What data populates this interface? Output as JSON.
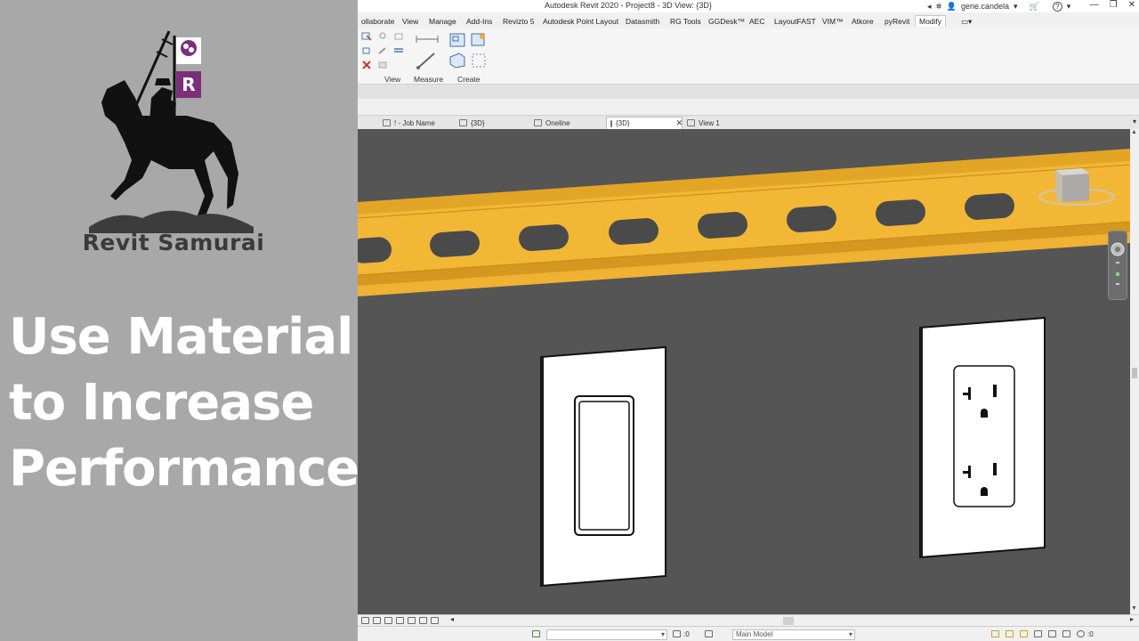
{
  "promo": {
    "brand_name": "Revit Samurai",
    "flag_letter": "R",
    "headline": [
      "Use Material",
      "to Increase",
      "Performance"
    ]
  },
  "window": {
    "title": "Autodesk Revit 2020 - Project8 - 3D View: {3D}",
    "user": "gene.candela",
    "help_glyph": "?"
  },
  "ribbon": {
    "tabs": [
      {
        "label": "ollaborate",
        "active": false
      },
      {
        "label": "View",
        "active": false
      },
      {
        "label": "Manage",
        "active": false
      },
      {
        "label": "Add-Ins",
        "active": false
      },
      {
        "label": "Revizto 5",
        "active": false
      },
      {
        "label": "Autodesk Point Layout",
        "active": false
      },
      {
        "label": "Datasmith",
        "active": false
      },
      {
        "label": "RG Tools",
        "active": false
      },
      {
        "label": "GGDesk™",
        "active": false
      },
      {
        "label": "AEC",
        "active": false
      },
      {
        "label": "LayoutFAST",
        "active": false
      },
      {
        "label": "VIM™",
        "active": false
      },
      {
        "label": "Atkore",
        "active": false
      },
      {
        "label": "pyRevit",
        "active": false
      },
      {
        "label": "Modify",
        "active": true
      }
    ],
    "groups": [
      "View",
      "Measure",
      "Create"
    ]
  },
  "view_tabs": [
    {
      "label": "! - Job Name",
      "active": false
    },
    {
      "label": "{3D}",
      "active": false
    },
    {
      "label": "Oneline",
      "active": false
    },
    {
      "label": "{3D}",
      "active": true
    },
    {
      "label": "View 1",
      "active": false
    }
  ],
  "status_bar": {
    "selection_count": ":0",
    "workset": "Main Model",
    "filter_count": ":0"
  },
  "colors": {
    "strut": "#f2b535",
    "viewport_bg": "#555555",
    "flag": "#7b2f7b"
  }
}
